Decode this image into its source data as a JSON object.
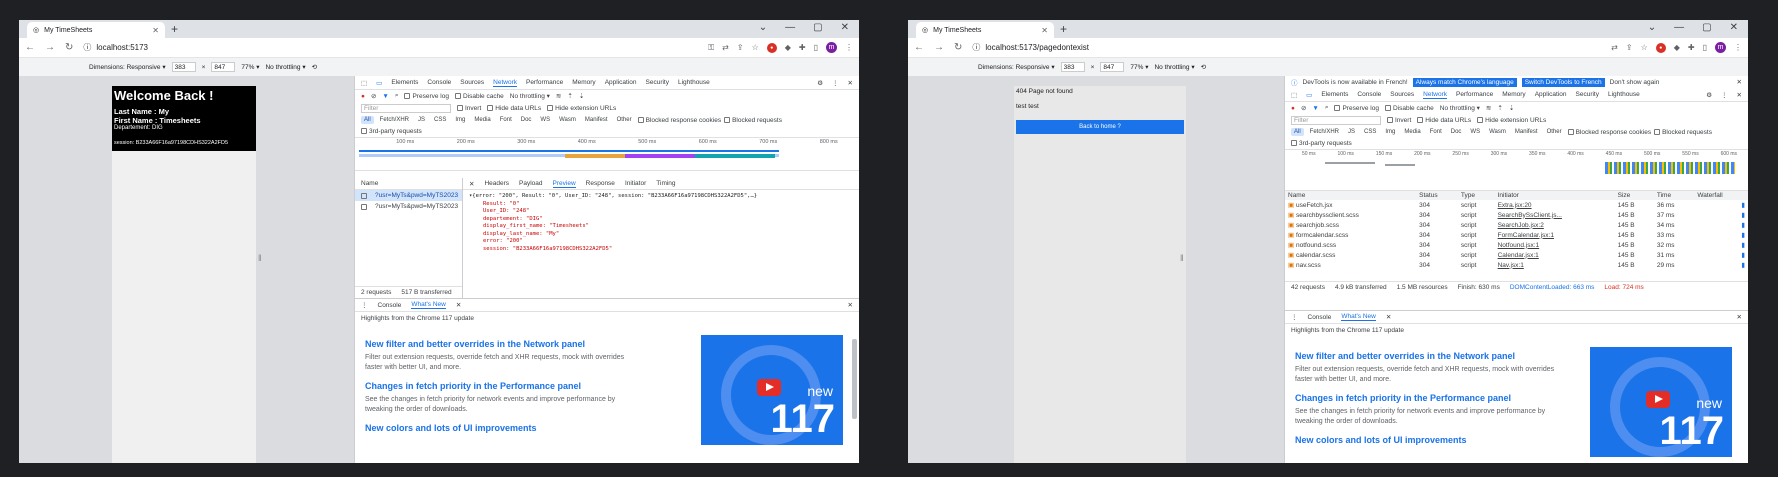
{
  "w1": {
    "tab_title": "My TimeSheets",
    "url": "localhost:5173",
    "device": {
      "dimensions": "Dimensions: Responsive ▾",
      "width": "383",
      "height": "847",
      "zoom": "77% ▾",
      "throttle": "No throttling ▾"
    },
    "page": {
      "welcome": "Welcome Back !",
      "last_name": "Last Name : My",
      "first_name": "First Name : Timesheets",
      "department": "Departement: DIG",
      "session": "session: B233A66F16a97198CDHS322A2FD5"
    },
    "dev_tabs": [
      "Elements",
      "Console",
      "Sources",
      "Network",
      "Performance",
      "Memory",
      "Application",
      "Security",
      "Lighthouse"
    ],
    "net": {
      "preserve": "Preserve log",
      "disable_cache": "Disable cache",
      "throttle": "No throttling ▾",
      "filter": "Filter",
      "invert": "Invert",
      "hide_data": "Hide data URLs",
      "hide_ext": "Hide extension URLs",
      "types": [
        "All",
        "Fetch/XHR",
        "JS",
        "CSS",
        "Img",
        "Media",
        "Font",
        "Doc",
        "WS",
        "Wasm",
        "Manifest",
        "Other"
      ],
      "blocked_cookies": "Blocked response cookies",
      "blocked_req": "Blocked requests",
      "third_party": "3rd-party requests",
      "ticks": [
        "100 ms",
        "200 ms",
        "300 ms",
        "400 ms",
        "500 ms",
        "600 ms",
        "700 ms",
        "800 ms"
      ],
      "name_header": "Name",
      "requests": [
        "?usr=MyTs&pwd=MyTS2023",
        "?usr=MyTs&pwd=MyTS2023"
      ],
      "detail_tabs": [
        "Headers",
        "Payload",
        "Preview",
        "Response",
        "Initiator",
        "Timing"
      ],
      "preview": [
        "▾{error: \"200\", Result: \"0\", User_ID: \"248\", session: \"B233A66F16a97198CDHS322A2FD5\",…}",
        "Result: \"0\"",
        "User_ID: \"248\"",
        "departement: \"DIG\"",
        "display_first_name: \"Timesheets\"",
        "display_last_name: \"My\"",
        "error: \"200\"",
        "session: \"B233A66F16a97198CDHS322A2FD5\""
      ],
      "status": [
        "2 requests",
        "517 B transferred"
      ]
    },
    "drawer": {
      "tabs": [
        "Console",
        "What's New"
      ],
      "highlights": "Highlights from the Chrome 117 update",
      "f1_title": "New filter and better overrides in the Network panel",
      "f1_text": "Filter out extension requests, override fetch and XHR requests, mock with overrides faster with better UI, and more.",
      "f2_title": "Changes in fetch priority in the Performance panel",
      "f2_text": "See the changes in fetch priority for network events and improve performance by tweaking the order of downloads.",
      "f3_title": "New colors and lots of UI improvements",
      "thumb_new": "new",
      "thumb_num": "117"
    }
  },
  "w2": {
    "tab_title": "My TimeSheets",
    "url": "localhost:5173/pagedontexist",
    "device": {
      "dimensions": "Dimensions: Responsive ▾",
      "width": "383",
      "height": "847",
      "zoom": "77% ▾",
      "throttle": "No throttling ▾"
    },
    "page": {
      "notfound": "404 Page not found",
      "test": "test test",
      "back": "Back to home ?"
    },
    "lang": {
      "msg": "DevTools is now available in French!",
      "btn1": "Always match Chrome's language",
      "btn2": "Switch DevTools to French",
      "btn3": "Don't show again"
    },
    "cols": [
      "Name",
      "Status",
      "Type",
      "Initiator",
      "Size",
      "Time",
      "Waterfall"
    ],
    "rows": [
      {
        "name": "useFetch.jsx",
        "status": "304",
        "type": "script",
        "init": "Extra.jsx:20",
        "size": "145 B",
        "time": "36 ms"
      },
      {
        "name": "searchbyssclient.scss",
        "status": "304",
        "type": "script",
        "init": "SearchBySsClient.js...",
        "size": "145 B",
        "time": "37 ms"
      },
      {
        "name": "searchjob.scss",
        "status": "304",
        "type": "script",
        "init": "SearchJob.jsx:2",
        "size": "145 B",
        "time": "34 ms"
      },
      {
        "name": "formcalendar.scss",
        "status": "304",
        "type": "script",
        "init": "FormCalendar.jsx:1",
        "size": "145 B",
        "time": "33 ms"
      },
      {
        "name": "notfound.scss",
        "status": "304",
        "type": "script",
        "init": "Notfound.jsx:1",
        "size": "145 B",
        "time": "32 ms"
      },
      {
        "name": "calendar.scss",
        "status": "304",
        "type": "script",
        "init": "Calendar.jsx:1",
        "size": "145 B",
        "time": "31 ms"
      },
      {
        "name": "nav.scss",
        "status": "304",
        "type": "script",
        "init": "Nav.jsx:1",
        "size": "145 B",
        "time": "29 ms"
      }
    ],
    "status": {
      "requests": "42 requests",
      "transferred": "4.9 kB transferred",
      "resources": "1.5 MB resources",
      "finish": "Finish: 630 ms",
      "dcl": "DOMContentLoaded: 663 ms",
      "load": "Load: 724 ms"
    },
    "ticks": [
      "50 ms",
      "100 ms",
      "150 ms",
      "200 ms",
      "250 ms",
      "300 ms",
      "350 ms",
      "400 ms",
      "450 ms",
      "500 ms",
      "550 ms",
      "600 ms"
    ]
  },
  "colors": {
    "accent": "#1a73e8",
    "black": "#000000"
  }
}
